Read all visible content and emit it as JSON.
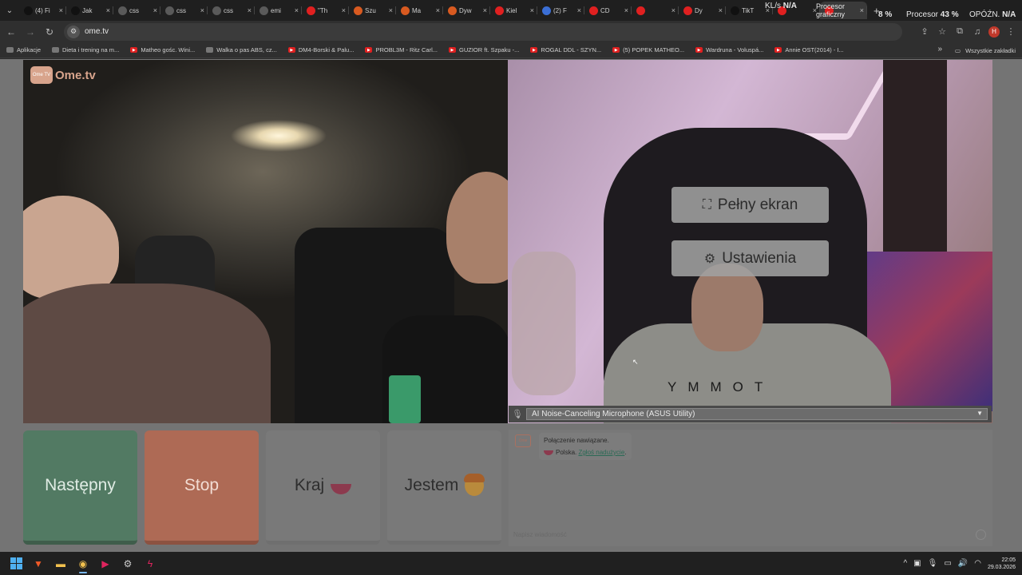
{
  "browser": {
    "tabs": [
      {
        "title": "(4) Fi",
        "icon": "tiktok-icon",
        "color": "#111111"
      },
      {
        "title": "Jak",
        "icon": "tiktok-icon",
        "color": "#111111"
      },
      {
        "title": "css",
        "icon": "web-icon",
        "color": "#5a5a5a"
      },
      {
        "title": "css",
        "icon": "web-icon",
        "color": "#5a5a5a"
      },
      {
        "title": "css",
        "icon": "web-icon",
        "color": "#5a5a5a"
      },
      {
        "title": "emi",
        "icon": "web-icon",
        "color": "#5a5a5a"
      },
      {
        "title": "\"Th",
        "icon": "youtube-icon",
        "color": "#e02020"
      },
      {
        "title": "Szu",
        "icon": "allegro-icon",
        "color": "#d85a20"
      },
      {
        "title": "Ma",
        "icon": "shop-icon",
        "color": "#d85a20"
      },
      {
        "title": "Dyw",
        "icon": "shop-icon",
        "color": "#d85a20"
      },
      {
        "title": "Kiel",
        "icon": "youtube-icon",
        "color": "#e02020"
      },
      {
        "title": "(2) F",
        "icon": "facebook-icon",
        "color": "#3b6fd6"
      },
      {
        "title": "CD",
        "icon": "youtube-icon",
        "color": "#e02020"
      },
      {
        "title": "",
        "icon": "youtube-icon",
        "color": "#e02020"
      },
      {
        "title": "Dy",
        "icon": "youtube-icon",
        "color": "#e02020"
      },
      {
        "title": "TikT",
        "icon": "tiktok-icon",
        "color": "#111111"
      },
      {
        "title": "",
        "icon": "youtube-icon",
        "color": "#e02020"
      },
      {
        "title": "",
        "icon": "youtube-icon",
        "color": "#e02020"
      }
    ],
    "active_tab_title": "",
    "new_tab": "+",
    "url": "ome.tv",
    "stats": {
      "network_label": "KL/s",
      "network_value": "N/A",
      "gpu_label": "Procesor graficzny",
      "gpu_value": "8 %",
      "cpu_label": "Procesor",
      "cpu_value": "43 %",
      "latency_label": "OPÓŹN.",
      "latency_value": "N/A"
    }
  },
  "bookmarks": {
    "items": [
      {
        "label": "Aplikacje",
        "icon": "apps-icon"
      },
      {
        "label": "Dieta i trening na m...",
        "icon": "bookmark-icon"
      },
      {
        "label": "Matheo gośc. Wini...",
        "icon": "youtube-icon"
      },
      {
        "label": "Walka o pas ABS, cz...",
        "icon": "bookmark-icon"
      },
      {
        "label": "DM4-Borski & Palu...",
        "icon": "youtube-icon"
      },
      {
        "label": "PROBL3M - Ritz Carl...",
        "icon": "youtube-icon"
      },
      {
        "label": "GUZIOR ft. Szpaku -...",
        "icon": "youtube-icon"
      },
      {
        "label": "ROGAL DDL - SZYN...",
        "icon": "youtube-icon"
      },
      {
        "label": "(5) POPEK MATHEO...",
        "icon": "youtube-icon"
      },
      {
        "label": "Wardruna - Voluspá...",
        "icon": "youtube-icon"
      },
      {
        "label": "Annie OST(2014) - I...",
        "icon": "youtube-icon"
      }
    ],
    "all_bookmarks": "Wszystkie zakładki"
  },
  "page": {
    "logo_badge": "Ome TV",
    "logo_text": "Ome.tv",
    "fullscreen_label": "Pełny ekran",
    "settings_label": "Ustawienia",
    "shirt_text": "YMMOT",
    "microphone": "AI Noise-Canceling Microphone (ASUS Utility)",
    "buttons": {
      "next": "Następny",
      "stop": "Stop",
      "country": "Kraj",
      "i_am": "Jestem"
    },
    "chat": {
      "status_line": "Połączenie nawiązane.",
      "country": "Polska.",
      "report_link": "Zgłoś nadużycie",
      "report_suffix": ".",
      "input_placeholder": "Napisz wiadomość"
    }
  },
  "taskbar": {
    "time": "22:05",
    "date": "29.03.2026"
  },
  "colors": {
    "next": "#527a63",
    "stop": "#ae6a55",
    "brand": "#d8a48c"
  }
}
